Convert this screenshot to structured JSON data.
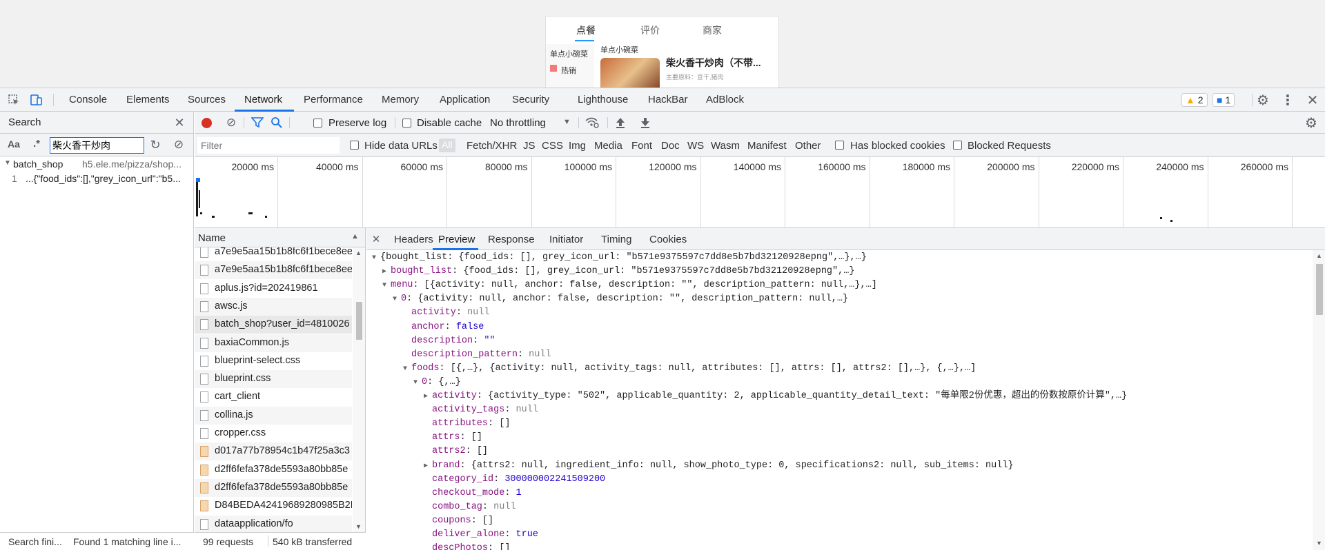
{
  "page_preview": {
    "tabs": [
      "点餐",
      "评价",
      "商家"
    ],
    "sidebar_item": "单点小碗菜",
    "sidebar_item2": "热销",
    "section_title": "单点小碗菜",
    "food_title": "柴火香干炒肉（不带...",
    "food_ingredients": "主要原料：豆干,猪肉"
  },
  "devtools": {
    "tabs": [
      "Console",
      "Elements",
      "Sources",
      "Network",
      "Performance",
      "Memory",
      "Application",
      "Security",
      "Lighthouse",
      "HackBar",
      "AdBlock"
    ],
    "warnings": "2",
    "messages": "1",
    "search": {
      "title": "Search",
      "aa": "Aa",
      "regex": ".*",
      "query": "柴火香干炒肉",
      "result_file": "batch_shop",
      "result_url": "h5.ele.me/pizza/shop...",
      "result_line_no": "1",
      "result_line": "...{\"food_ids\":[],\"grey_icon_url\":\"b5...",
      "status_left": "Search fini...",
      "status_right": "Found 1 matching line i..."
    },
    "network": {
      "preserve_log": "Preserve log",
      "disable_cache": "Disable cache",
      "throttling": "No throttling",
      "filter_placeholder": "Filter",
      "hide_data_urls": "Hide data URLs",
      "types": [
        "All",
        "Fetch/XHR",
        "JS",
        "CSS",
        "Img",
        "Media",
        "Font",
        "Doc",
        "WS",
        "Wasm",
        "Manifest",
        "Other"
      ],
      "has_blocked_cookies": "Has blocked cookies",
      "blocked_requests": "Blocked Requests",
      "ticks": [
        "20000 ms",
        "40000 ms",
        "60000 ms",
        "80000 ms",
        "100000 ms",
        "120000 ms",
        "140000 ms",
        "160000 ms",
        "180000 ms",
        "200000 ms",
        "220000 ms",
        "240000 ms",
        "260000 ms"
      ],
      "name_header": "Name",
      "requests": [
        {
          "name": "a7e9e5aa15b1b8fc6f1bece8ee",
          "type": "doc"
        },
        {
          "name": "a7e9e5aa15b1b8fc6f1bece8ee",
          "type": "doc"
        },
        {
          "name": "aplus.js?id=202419861",
          "type": "doc"
        },
        {
          "name": "awsc.js",
          "type": "doc"
        },
        {
          "name": "batch_shop?user_id=4810026",
          "type": "doc"
        },
        {
          "name": "baxiaCommon.js",
          "type": "doc"
        },
        {
          "name": "blueprint-select.css",
          "type": "doc"
        },
        {
          "name": "blueprint.css",
          "type": "doc"
        },
        {
          "name": "cart_client",
          "type": "doc"
        },
        {
          "name": "collina.js",
          "type": "doc"
        },
        {
          "name": "cropper.css",
          "type": "doc"
        },
        {
          "name": "d017a77b78954c1b47f25a3c3",
          "type": "img"
        },
        {
          "name": "d2ff6fefa378de5593a80bb85e",
          "type": "img"
        },
        {
          "name": "d2ff6fefa378de5593a80bb85e",
          "type": "img"
        },
        {
          "name": "D84BEDA42419689280985B2F",
          "type": "img"
        },
        {
          "name": "dataapplication/fo",
          "type": "doc"
        }
      ],
      "summary_requests": "99 requests",
      "summary_transferred": "540 kB transferred",
      "detail_tabs": [
        "Headers",
        "Preview",
        "Response",
        "Initiator",
        "Timing",
        "Cookies"
      ]
    },
    "preview_lines": [
      {
        "indent": 0,
        "tri": "down",
        "key": "",
        "text": "{bought_list: {food_ids: [], grey_icon_url: \"b571e9375597c7dd8e5b7bd32120928epng\",…},…}",
        "cls": ""
      },
      {
        "indent": 1,
        "tri": "right",
        "key": "bought_list",
        "text": "{food_ids: [], grey_icon_url: \"b571e9375597c7dd8e5b7bd32120928epng\",…}",
        "cls": ""
      },
      {
        "indent": 1,
        "tri": "down",
        "key": "menu",
        "text": "[{activity: null, anchor: false, description: \"\", description_pattern: null,…},…]",
        "cls": ""
      },
      {
        "indent": 2,
        "tri": "down",
        "key": "0",
        "text": "{activity: null, anchor: false, description: \"\", description_pattern: null,…}",
        "cls": ""
      },
      {
        "indent": 3,
        "tri": "",
        "key": "activity",
        "text": "null",
        "cls": "nl"
      },
      {
        "indent": 3,
        "tri": "",
        "key": "anchor",
        "text": "false",
        "cls": "n"
      },
      {
        "indent": 3,
        "tri": "",
        "key": "description",
        "text": "\"\"",
        "cls": "s"
      },
      {
        "indent": 3,
        "tri": "",
        "key": "description_pattern",
        "text": "null",
        "cls": "nl"
      },
      {
        "indent": 3,
        "tri": "down",
        "key": "foods",
        "text": "[{,…}, {activity: null, activity_tags: null, attributes: [], attrs: [], attrs2: [],…}, {,…},…]",
        "cls": ""
      },
      {
        "indent": 4,
        "tri": "down",
        "key": "0",
        "text": "{,…}",
        "cls": ""
      },
      {
        "indent": 5,
        "tri": "right",
        "key": "activity",
        "text": "{activity_type: \"502\", applicable_quantity: 2, applicable_quantity_detail_text: \"每单限2份优惠，超出的份数按原价计算\",…}",
        "cls": ""
      },
      {
        "indent": 5,
        "tri": "",
        "key": "activity_tags",
        "text": "null",
        "cls": "nl"
      },
      {
        "indent": 5,
        "tri": "",
        "key": "attributes",
        "text": "[]",
        "cls": ""
      },
      {
        "indent": 5,
        "tri": "",
        "key": "attrs",
        "text": "[]",
        "cls": ""
      },
      {
        "indent": 5,
        "tri": "",
        "key": "attrs2",
        "text": "[]",
        "cls": ""
      },
      {
        "indent": 5,
        "tri": "right",
        "key": "brand",
        "text": "{attrs2: null, ingredient_info: null, show_photo_type: 0, specifications2: null, sub_items: null}",
        "cls": ""
      },
      {
        "indent": 5,
        "tri": "",
        "key": "category_id",
        "text": "300000002241509200",
        "cls": "n"
      },
      {
        "indent": 5,
        "tri": "",
        "key": "checkout_mode",
        "text": "1",
        "cls": "n"
      },
      {
        "indent": 5,
        "tri": "",
        "key": "combo_tag",
        "text": "null",
        "cls": "nl"
      },
      {
        "indent": 5,
        "tri": "",
        "key": "coupons",
        "text": "[]",
        "cls": ""
      },
      {
        "indent": 5,
        "tri": "",
        "key": "deliver_alone",
        "text": "true",
        "cls": "n"
      },
      {
        "indent": 5,
        "tri": "",
        "key": "descPhotos",
        "text": "[]",
        "cls": ""
      }
    ]
  }
}
